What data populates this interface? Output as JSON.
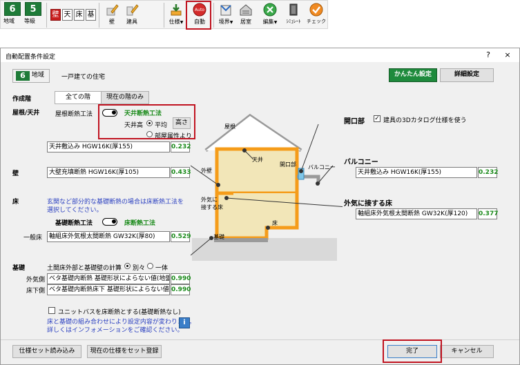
{
  "toolbar": {
    "region": {
      "num": "6",
      "label": "地域"
    },
    "grade": {
      "num": "5",
      "label": "等級"
    },
    "kanji": [
      "壁",
      "天",
      "床",
      "基"
    ],
    "buttons": {
      "wall": "壁",
      "fitting": "建具",
      "spec": "仕様",
      "auto": "自動",
      "auto_icon_text": "Auto",
      "boundary": "境界",
      "room": "居室",
      "edit": "編集",
      "simulate": "ｼﾐｭﾚｰﾄ",
      "check": "チェック"
    }
  },
  "dialog": {
    "title": "自動配置条件設定",
    "help": "?",
    "close": "×",
    "region_num": "6",
    "region_label": "地域",
    "house_type": "一戸建ての住宅",
    "easy_setting": "かんたん設定",
    "detail_setting": "詳細設定",
    "floors_heading": "作成階",
    "tab_all_floors": "全ての階",
    "tab_current_floor": "現在の階のみ",
    "roof": {
      "heading": "屋根/天井",
      "method_label": "屋根断熱工法",
      "method_value": "天井断熱工法",
      "ceiling_height_label": "天井高",
      "option_average": "平均",
      "height_button": "高さ",
      "option_by_room": "部屋属性より",
      "material": "天井敷込み HGW16K(厚155)",
      "value": "0.232"
    },
    "wall": {
      "heading": "壁",
      "material": "大壁充填断熱 HGW16K(厚105)",
      "value": "0.433"
    },
    "floor": {
      "heading": "床",
      "note_line1": "玄関など部分的な基礎断熱の場合は床断熱工法を",
      "note_line2": "選択してください。",
      "method_label": "基礎断熱工法",
      "method_value": "床断熱工法",
      "general_label": "一般床",
      "material": "軸組床外気根太間断熱 GW32K(厚80)",
      "value": "0.529"
    },
    "foundation": {
      "heading": "基礎",
      "calc_label": "土間床外部と基礎壁の計算",
      "option_separate": "別々",
      "option_together": "一体",
      "outer_label": "外気側",
      "outer_material": "ベタ基礎内断熱 基礎形状によらない値(地盤",
      "outer_value": "0.990",
      "under_label": "床下側",
      "under_material": "ベタ基礎内断熱床下 基礎形状によらない値(",
      "under_value": "0.990"
    },
    "unit_bath": {
      "label": "ユニットバスを床断熱とする(基礎断熱なし)",
      "note_line1": "床と基礎の組み合わせにより設定内容が変わります。",
      "note_line2": "詳しくはインフォメーションをご確認ください。"
    },
    "opening": {
      "heading": "開口部",
      "check_label": "建具の3Dカタログ仕様を使う"
    },
    "balcony": {
      "heading": "バルコニー",
      "material": "天井敷込み HGW16K(厚155)",
      "value": "0.232"
    },
    "outer_floor": {
      "heading": "外気に接する床",
      "material": "軸組床外気根太間断熱 GW32K(厚120)",
      "value": "0.377"
    },
    "diagram": {
      "roof": "屋根",
      "ceiling": "天井",
      "opening": "開口部",
      "balcony": "バルコニー",
      "outer_wall": "外壁",
      "outer_floor_1": "外気に",
      "outer_floor_2": "接する床",
      "floor": "床",
      "foundation": "基礎"
    },
    "footer": {
      "load_spec": "仕様セット読み込み",
      "register_spec": "現在の仕様をセット登録",
      "ok": "完了",
      "cancel": "キャンセル"
    }
  },
  "colors": {
    "insulation": "#f59c1a",
    "wall_fill": "#f2e6b8",
    "accent_green": "#1e8a3c",
    "highlight_red": "#c0121f"
  }
}
